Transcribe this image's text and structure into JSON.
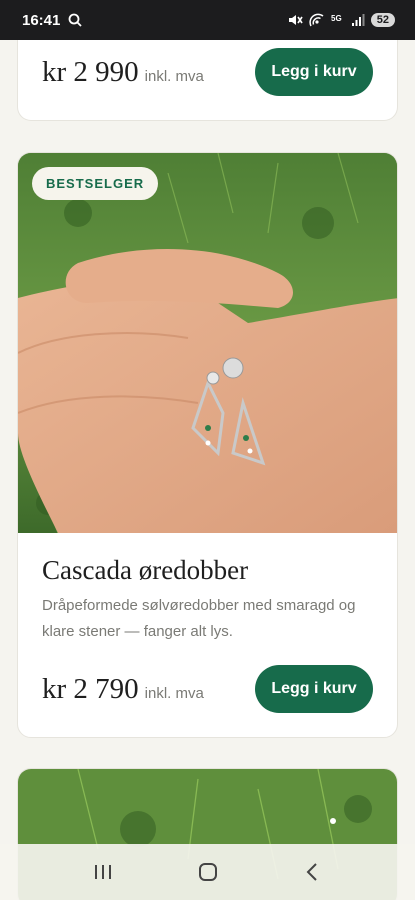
{
  "status_bar": {
    "time": "16:41",
    "battery": "52",
    "icons": [
      "search-icon",
      "mute-icon",
      "hotspot-icon",
      "5g-icon",
      "signal-icon",
      "battery-icon"
    ]
  },
  "products": [
    {
      "price": "kr 2 990",
      "vat_label": "inkl. mva",
      "cart_label": "Legg i kurv"
    },
    {
      "badge": "BESTSELGER",
      "title": "Cascada øredobber",
      "description": "Dråpeformede sølvøredobber med smaragd og klare stener — fanger alt lys.",
      "price": "kr 2 790",
      "vat_label": "inkl. mva",
      "cart_label": "Legg i kurv"
    }
  ],
  "nav": {
    "icons": [
      "recent-apps-icon",
      "home-icon",
      "back-icon"
    ]
  },
  "colors": {
    "accent": "#176b4b",
    "background": "#f5f4ef",
    "card": "#ffffff"
  }
}
